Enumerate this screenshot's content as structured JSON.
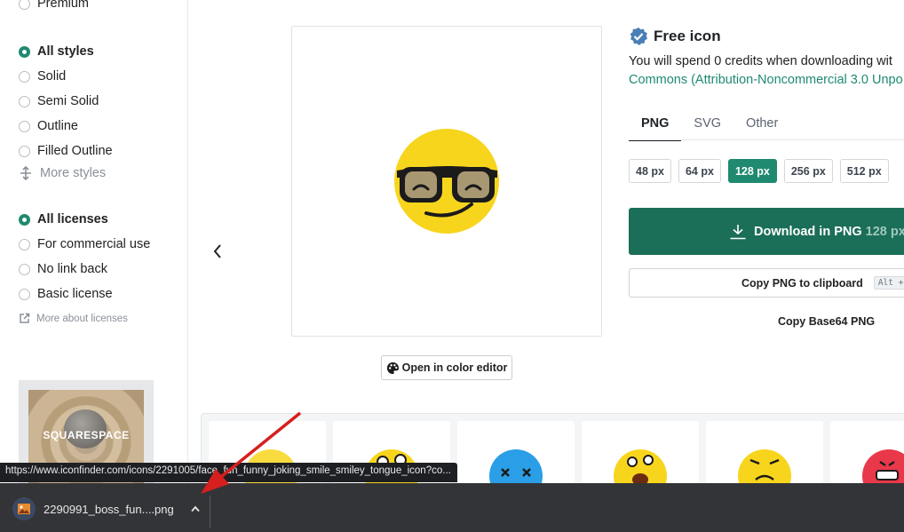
{
  "sidebar": {
    "premium_label": "Premium",
    "styles": [
      {
        "label": "All styles",
        "selected": true
      },
      {
        "label": "Solid",
        "selected": false
      },
      {
        "label": "Semi Solid",
        "selected": false
      },
      {
        "label": "Outline",
        "selected": false
      },
      {
        "label": "Filled Outline",
        "selected": false
      }
    ],
    "more_styles": "More styles",
    "licenses": [
      {
        "label": "All licenses",
        "selected": true
      },
      {
        "label": "For commercial use",
        "selected": false
      },
      {
        "label": "No link back",
        "selected": false
      },
      {
        "label": "Basic license",
        "selected": false
      }
    ],
    "more_licenses": "More about licenses",
    "ad_text": "SQUARESPACE"
  },
  "preview": {
    "icon": "sunglasses-smirk-face-icon",
    "open_editor": "Open in color editor"
  },
  "details": {
    "title": "Free icon",
    "credits_text": "You will spend 0 credits when downloading wit",
    "license_text": "Commons (Attribution-Noncommercial 3.0 Unpo",
    "tabs": [
      "PNG",
      "SVG",
      "Other"
    ],
    "active_tab": "PNG",
    "sizes": [
      "48 px",
      "64 px",
      "128 px",
      "256 px",
      "512 px"
    ],
    "selected_size": "128 px",
    "download_label": "Download in PNG",
    "download_size": "128 px",
    "copy_label": "Copy PNG to clipboard",
    "copy_shortcut": "Alt + :",
    "base64_label": "Copy Base64 PNG"
  },
  "colors": {
    "accent": "#1f8a70",
    "download_button": "#1b6e57",
    "emoji_yellow": "#f7d51d"
  },
  "browser": {
    "status_url": "https://www.iconfinder.com/icons/2291005/face_fun_funny_joking_smile_smiley_tongue_icon?co...",
    "download_file": "2290991_boss_fun....png"
  }
}
